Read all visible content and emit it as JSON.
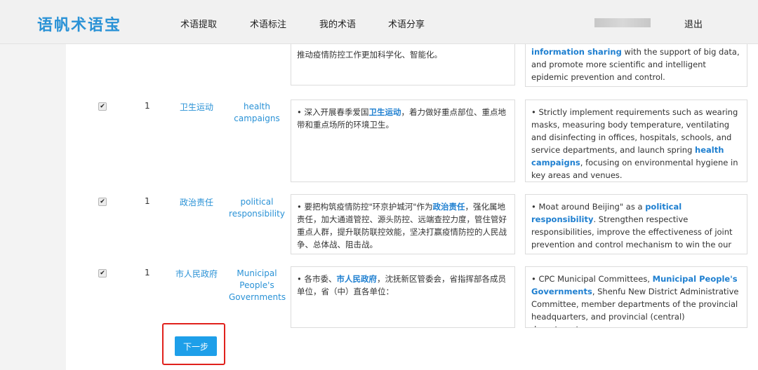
{
  "navbar": {
    "brand": "语帆术语宝",
    "items": [
      "术语提取",
      "术语标注",
      "我的术语",
      "术语分享"
    ],
    "logout": "退出"
  },
  "rows": [
    {
      "zh_parts": [
        "推动疫情防控工作更加科学化、智能化。"
      ],
      "en_parts": [
        "",
        "information sharing",
        " with the support of big data, and promote more scientific and intelligent epidemic prevention and control."
      ]
    },
    {
      "checked": "✔",
      "count": "1",
      "term_zh": "卫生运动",
      "term_en": "health campaigns",
      "zh_parts": [
        "• 深入开展春季爱国",
        "卫生运动",
        "，着力做好重点部位、重点地带和重点场所的环境卫生。"
      ],
      "en_parts": [
        "• Strictly implement requirements such as wearing masks, measuring body temperature, ventilating and disinfecting in offices, hospitals, schools, and service departments, and launch spring ",
        "health campaigns",
        ", focusing on environmental hygiene in key areas and venues."
      ]
    },
    {
      "checked": "✔",
      "count": "1",
      "term_zh": "政治责任",
      "term_en": "political responsibility",
      "zh_parts": [
        "• 要把构筑疫情防控\"环京护城河\"作为",
        "政治责任",
        "，强化属地责任，加大通道管控、源头防控、远端查控力度，管住管好重点人群，提升联防联控效能，坚决打赢疫情防控的人民战争、总体战、阻击战。"
      ],
      "en_parts": [
        "• Moat around Beijing\" as a ",
        "political responsibility",
        ". Strengthen respective responsibilities, improve the effectiveness of joint prevention and control mechanism to win the our war against the epidemic."
      ]
    },
    {
      "checked": "✔",
      "count": "1",
      "term_zh": "市人民政府",
      "term_en": "Municipal People's Governments",
      "zh_parts": [
        "• 各市委、",
        "市人民政府",
        "，沈抚新区管委会，省指挥部各成员单位，省（中）直各单位："
      ],
      "en_parts": [
        "• CPC Municipal Committees, ",
        "Municipal People's Governments",
        ", Shenfu New District Administrative Committee, member departments of the provincial headquarters, and provincial (central) departments:"
      ]
    }
  ],
  "next_button": "下一步"
}
